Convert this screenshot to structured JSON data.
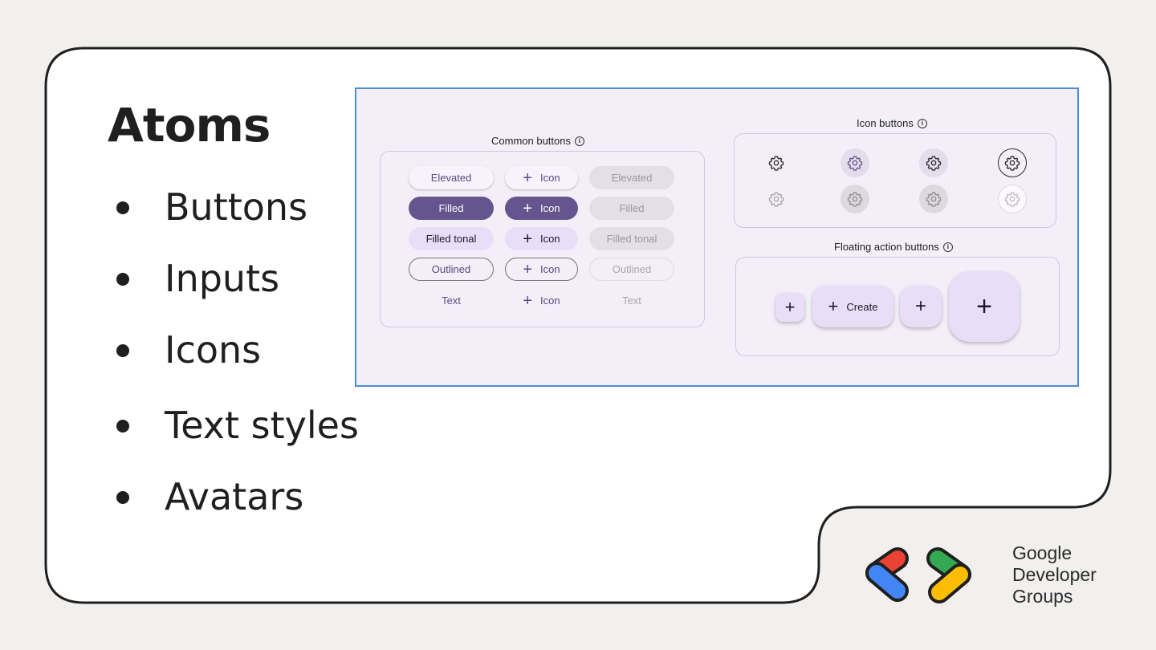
{
  "slide": {
    "title": "Atoms",
    "bullets": [
      "Buttons",
      "Inputs",
      "Icons",
      "Text styles",
      "Avatars"
    ]
  },
  "screenshot": {
    "common_buttons": {
      "label": "Common buttons",
      "rows": [
        [
          "Elevated",
          "Icon",
          "Elevated"
        ],
        [
          "Filled",
          "Icon",
          "Filled"
        ],
        [
          "Filled tonal",
          "Icon",
          "Filled tonal"
        ],
        [
          "Outlined",
          "Icon",
          "Outlined"
        ],
        [
          "Text",
          "Icon",
          "Text"
        ]
      ]
    },
    "icon_buttons": {
      "label": "Icon buttons",
      "icon": "gear-icon"
    },
    "fab": {
      "label": "Floating action buttons",
      "extended_label": "Create",
      "icon": "plus-icon"
    },
    "info_icon": "i"
  },
  "logo": {
    "line1": "Google",
    "line2": "Developer",
    "line3": "Groups",
    "colors": {
      "red": "#ea4335",
      "blue": "#4285f4",
      "green": "#34a853",
      "yellow": "#fbbc04"
    }
  },
  "colors": {
    "primary": "#65558f",
    "tonal": "#e8def8",
    "surface": "#f3eff9",
    "frame_border": "#4d8ae0"
  }
}
